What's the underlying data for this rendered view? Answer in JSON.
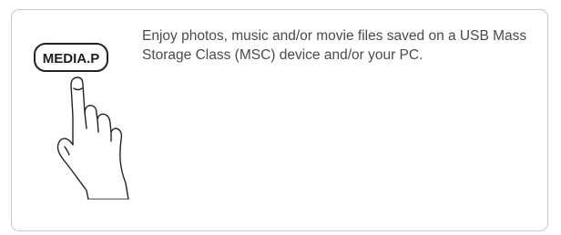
{
  "button_key": {
    "label": "MEDIA.P",
    "icon": "hand-pointer-icon"
  },
  "description": "Enjoy photos, music and/or movie files saved on a USB Mass Storage Class (MSC) device and/or your PC.",
  "colors": {
    "card_border": "#c9c9c9",
    "text": "#4a4a4a",
    "key_outline": "#222222"
  }
}
